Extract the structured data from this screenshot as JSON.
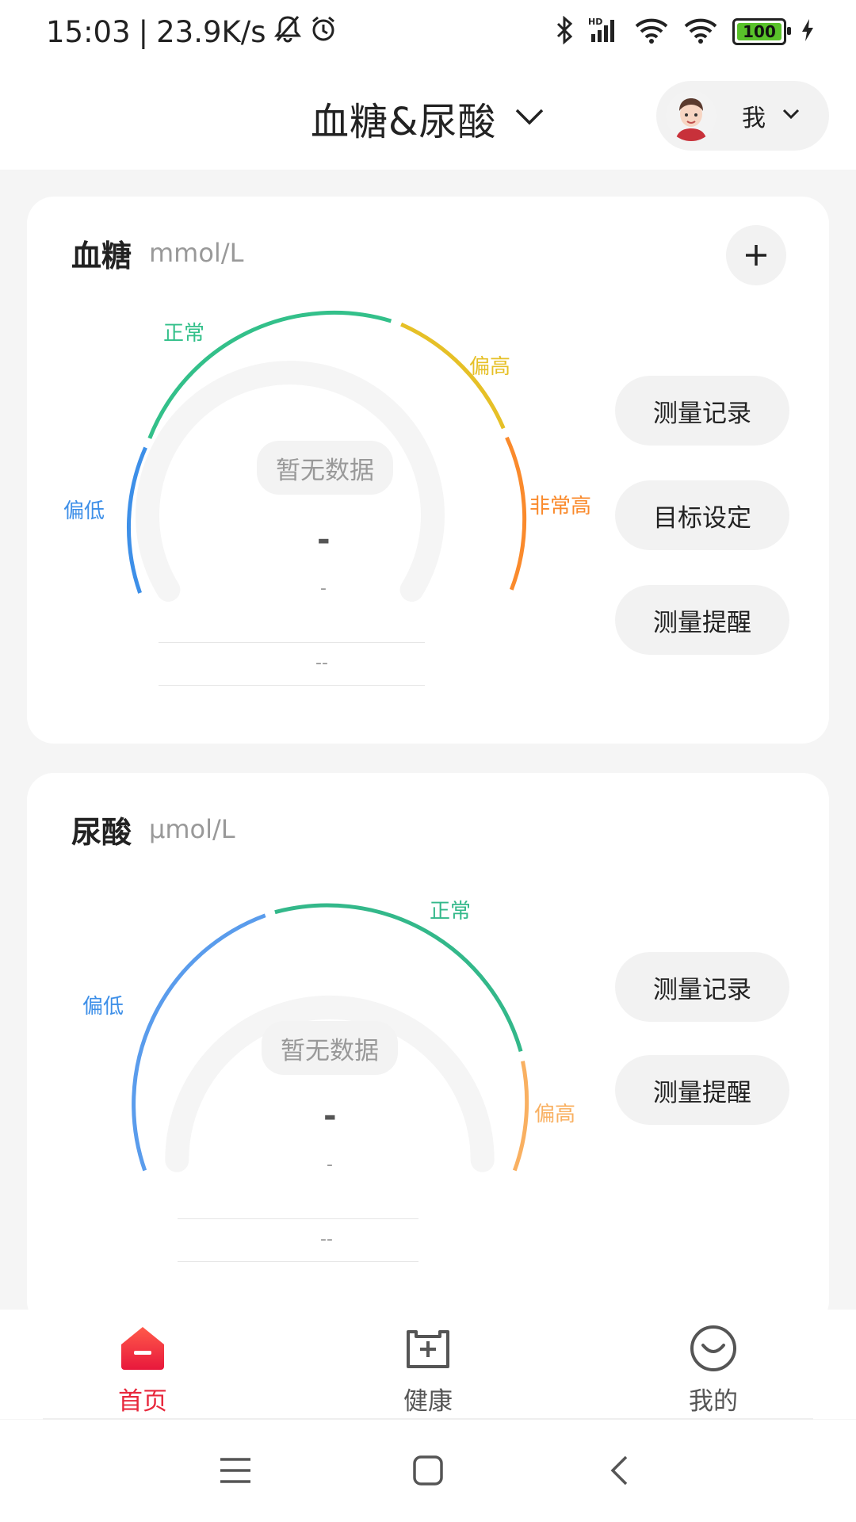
{
  "status_bar": {
    "time": "15:03",
    "separator": "|",
    "net_speed": "23.9K/s",
    "battery": "100",
    "icons": [
      "bell-off-icon",
      "alarm-icon",
      "bluetooth-icon",
      "signal-hd-icon",
      "wifi-icon",
      "wifi-icon",
      "battery-icon",
      "charging-icon"
    ]
  },
  "header": {
    "title": "血糖&尿酸",
    "user": "我"
  },
  "glucose": {
    "title": "血糖",
    "unit": "mmol/L",
    "zones": {
      "low": "偏低",
      "normal": "正常",
      "high": "偏高",
      "very_high": "非常高"
    },
    "no_data": "暂无数据",
    "value": "-",
    "sub": "-",
    "footer": "--",
    "buttons": {
      "records": "测量记录",
      "target": "目标设定",
      "reminder": "测量提醒"
    }
  },
  "uric": {
    "title": "尿酸",
    "unit": "μmol/L",
    "zones": {
      "low": "偏低",
      "normal": "正常",
      "high": "偏高"
    },
    "no_data": "暂无数据",
    "value": "-",
    "sub": "-",
    "footer": "--",
    "buttons": {
      "records": "测量记录",
      "reminder": "测量提醒"
    }
  },
  "bottom_nav": {
    "home": "首页",
    "health": "健康",
    "mine": "我的"
  },
  "colors": {
    "accent": "#e8283c",
    "low": "#3d8fe8",
    "normal": "#33c08a",
    "high": "#e6c027",
    "very_high": "#fa8a2c",
    "uric_high": "#f9b061"
  }
}
